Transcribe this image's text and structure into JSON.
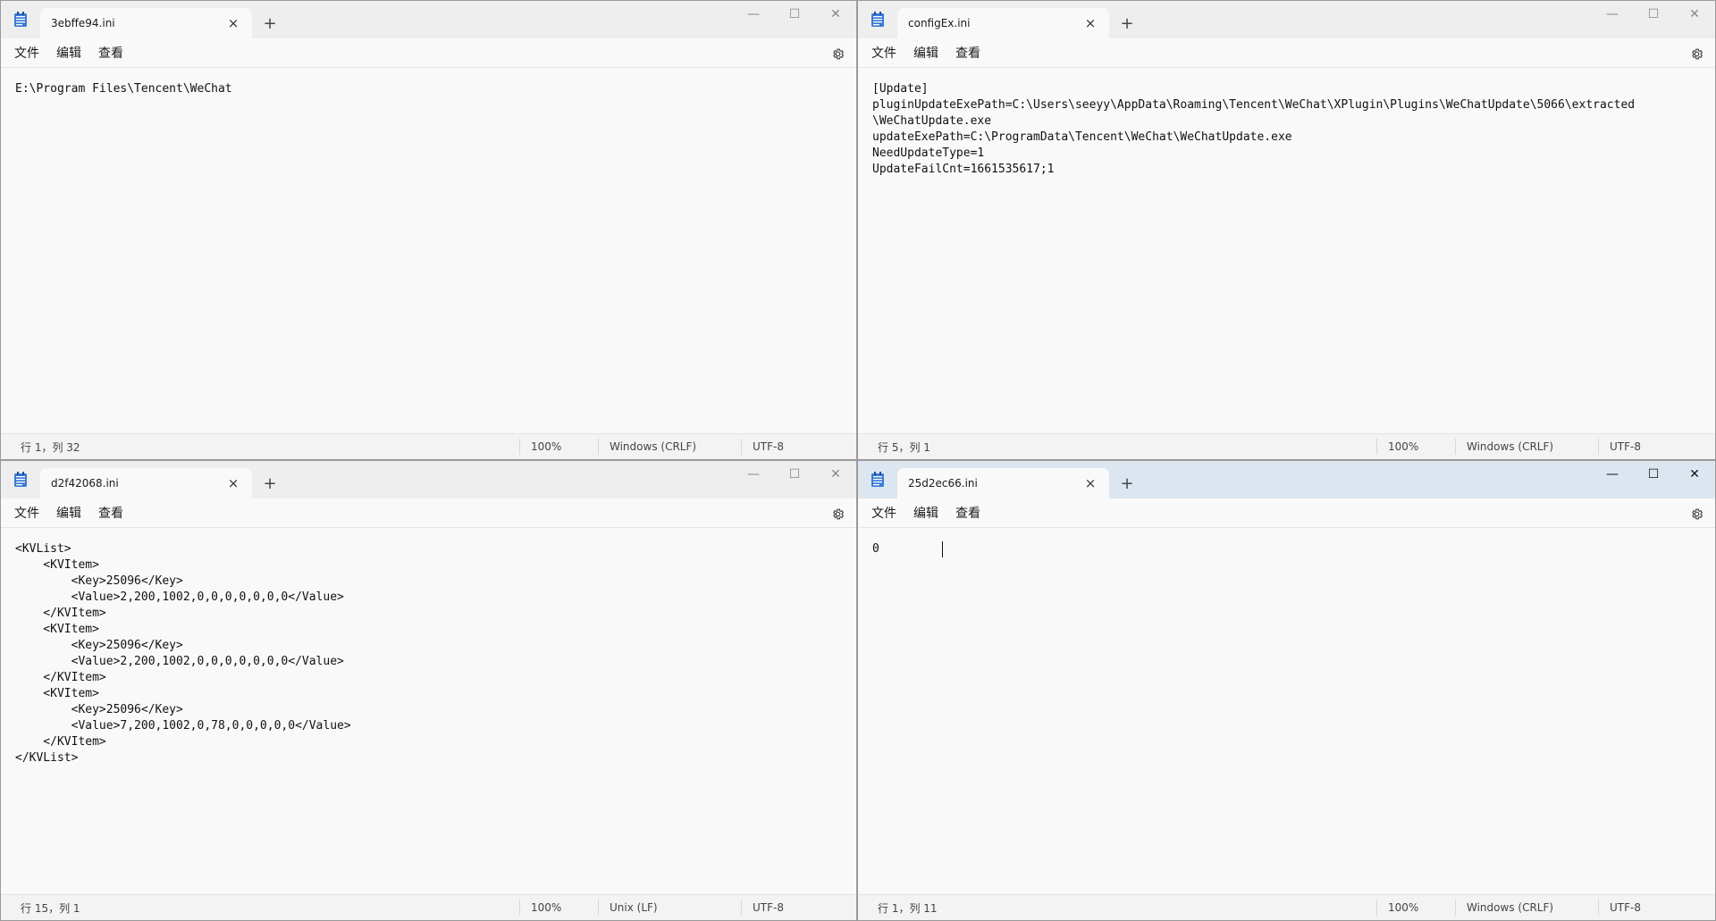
{
  "menu": {
    "file": "文件",
    "edit": "编辑",
    "view": "查看"
  },
  "icons": {
    "app": "notepad-icon",
    "close_tab": "×",
    "new_tab": "+",
    "minimize": "—",
    "maximize": "☐",
    "close": "✕",
    "settings": "gear-icon"
  },
  "windows": [
    {
      "tab_title": "3ebffe94.ini",
      "lines": [
        "E:\\Program Files\\Tencent\\WeChat"
      ],
      "status": {
        "position": "行 1，列 32",
        "zoom": "100%",
        "line_ending": "Windows (CRLF)",
        "encoding": "UTF-8"
      }
    },
    {
      "tab_title": "configEx.ini",
      "lines": [
        "[Update]",
        "pluginUpdateExePath=C:\\Users\\seeyy\\AppData\\Roaming\\Tencent\\WeChat\\XPlugin\\Plugins\\WeChatUpdate\\5066\\extracted",
        "\\WeChatUpdate.exe",
        "updateExePath=C:\\ProgramData\\Tencent\\WeChat\\WeChatUpdate.exe",
        "NeedUpdateType=1",
        "UpdateFailCnt=1661535617;1"
      ],
      "status": {
        "position": "行 5，列 1",
        "zoom": "100%",
        "line_ending": "Windows (CRLF)",
        "encoding": "UTF-8"
      }
    },
    {
      "tab_title": "d2f42068.ini",
      "lines": [
        "<KVList>",
        "    <KVItem>",
        "        <Key>25096</Key>",
        "        <Value>2,200,1002,0,0,0,0,0,0,0</Value>",
        "    </KVItem>",
        "    <KVItem>",
        "        <Key>25096</Key>",
        "        <Value>2,200,1002,0,0,0,0,0,0,0</Value>",
        "    </KVItem>",
        "    <KVItem>",
        "        <Key>25096</Key>",
        "        <Value>7,200,1002,0,78,0,0,0,0,0</Value>",
        "    </KVItem>",
        "</KVList>"
      ],
      "status": {
        "position": "行 15，列 1",
        "zoom": "100%",
        "line_ending": "Unix (LF)",
        "encoding": "UTF-8"
      }
    },
    {
      "tab_title": "25d2ec66.ini",
      "lines": [
        "0         "
      ],
      "status": {
        "position": "行 1，列 11",
        "zoom": "100%",
        "line_ending": "Windows (CRLF)",
        "encoding": "UTF-8"
      }
    }
  ]
}
